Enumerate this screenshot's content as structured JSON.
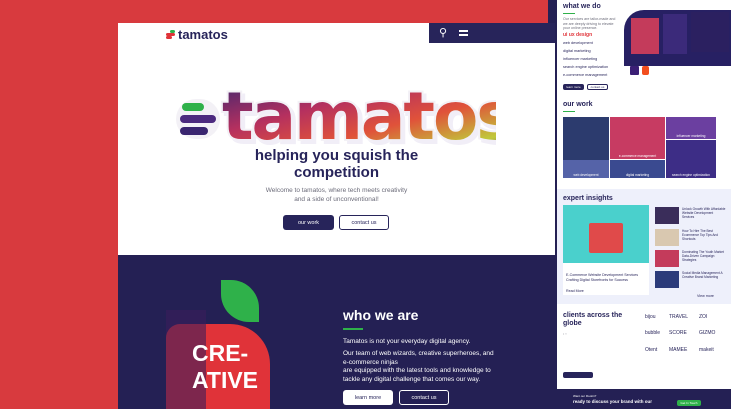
{
  "colors": {
    "brand_navy": "#27245a",
    "brand_red": "#d83a3e",
    "accent_green": "#2fb14a"
  },
  "main": {
    "logo_text": "tamatos",
    "nav_icons": [
      "search-icon",
      "menu-icon"
    ],
    "hero_word": "tamatos",
    "headline_line1": "helping you squish the",
    "headline_line2": "competition",
    "intro_line1": "Welcome to tamatos, where tech meets creativity",
    "intro_line2": "and a side of unconventional!",
    "btn_our_work": "our work",
    "btn_contact": "contact us",
    "who": {
      "title": "who we are",
      "p1": "Tamatos is not your everyday digital agency.",
      "p2_l1": "Our team of web wizards, creative superheroes, and",
      "p2_l2": "e-commerce ninjas",
      "p2_l3": "are equipped with the latest tools and knowledge to",
      "p2_l4": "tackle any digital challenge that comes our way.",
      "creative_l1": "CRE-",
      "creative_l2": "ATIVE",
      "btn_learn": "learn more",
      "btn_contact": "contact us"
    }
  },
  "side": {
    "what_title": "what we do",
    "what_desc": "Our services are tailor-made and we are deeply driving to elevate your online presence.",
    "services": [
      "ui ux design",
      "web development",
      "digital marketing",
      "influencer marketing",
      "search engine optimization",
      "e-commerce management"
    ],
    "btn_a": "learn more",
    "btn_b": "contact us",
    "our_work_title": "our work",
    "work_tiles": [
      "influencer marketing",
      "ui ux design",
      "e-commerce management",
      "web development",
      "digital marketing",
      "search engine optimization"
    ],
    "insights_title": "expert insights",
    "insights_list": [
      "Unlock Growth With Affordable Website Development Services",
      "How To Hire The Best Ecommerce Top Tips And Shortcuts",
      "Dominating The Youth Market Data-Driven Campaign Strategies",
      "Social Media Management A Creative Brand Marketing"
    ],
    "insight_main_title": "E-Commerce Website Development Services Crafting Digital Storefronts for Success",
    "read_more": "Read More",
    "view_more": "View more",
    "clients_title_l1": "clients across the",
    "clients_title_l2": "globe",
    "client_logos": [
      "bijou",
      "TRAVEL",
      "ZOI",
      "bubble",
      "SCORE",
      "GIZMO",
      "Otent",
      "MAMEE",
      "makeit"
    ],
    "foot_l1": "Want our Rootin?",
    "foot_l2": "ready to discuss your brand with our",
    "foot_btn": "Get In Touch"
  }
}
